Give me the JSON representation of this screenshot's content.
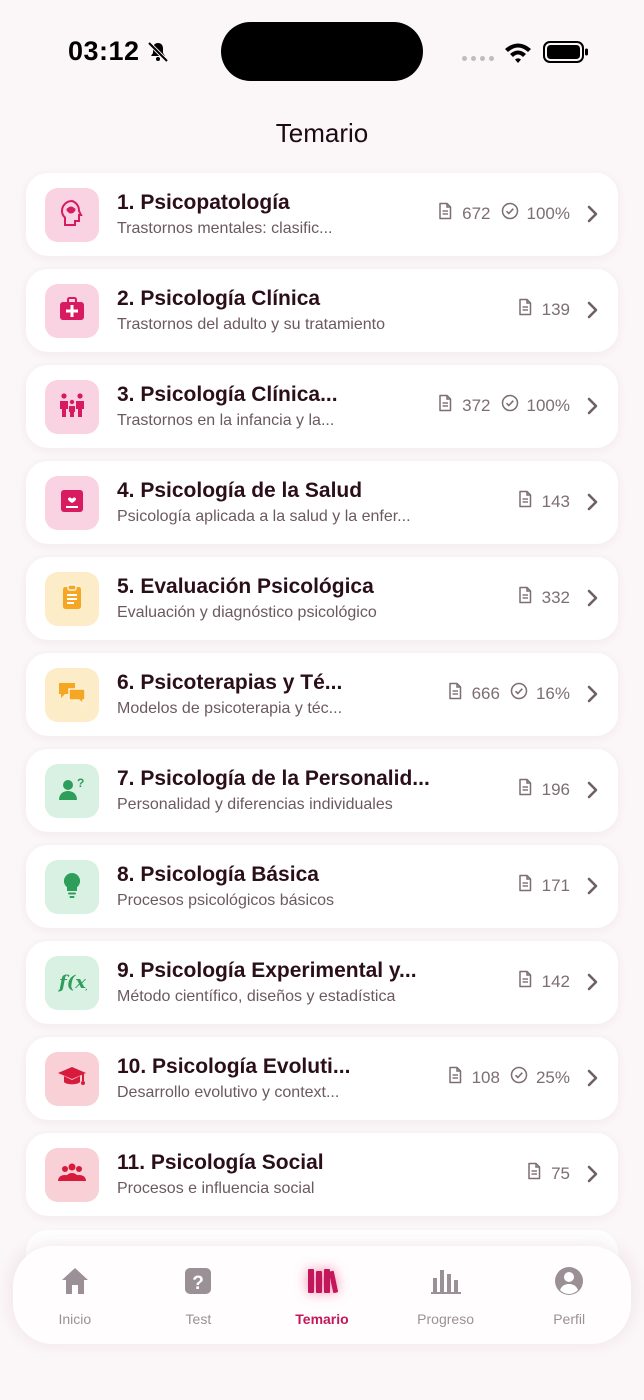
{
  "status": {
    "time": "03:12"
  },
  "page_title": "Temario",
  "topics": [
    {
      "title": "1. Psicopatología",
      "subtitle": "Trastornos mentales: clasific...",
      "count": "672",
      "progress": "100%",
      "icon": "brain-head-icon",
      "tone": "pink"
    },
    {
      "title": "2. Psicología Clínica",
      "subtitle": "Trastornos del adulto y su tratamiento",
      "count": "139",
      "progress": "",
      "icon": "medical-kit-icon",
      "tone": "pink"
    },
    {
      "title": "3. Psicología Clínica...",
      "subtitle": "Trastornos en la infancia y la...",
      "count": "372",
      "progress": "100%",
      "icon": "family-icon",
      "tone": "pink"
    },
    {
      "title": "4. Psicología de la Salud",
      "subtitle": "Psicología aplicada a la salud y la enfer...",
      "count": "143",
      "progress": "",
      "icon": "health-card-icon",
      "tone": "pink"
    },
    {
      "title": "5. Evaluación Psicológica",
      "subtitle": "Evaluación y diagnóstico psicológico",
      "count": "332",
      "progress": "",
      "icon": "clipboard-icon",
      "tone": "amber"
    },
    {
      "title": "6. Psicoterapias y Té...",
      "subtitle": "Modelos de psicoterapia y téc...",
      "count": "666",
      "progress": "16%",
      "icon": "chat-bubbles-icon",
      "tone": "amber"
    },
    {
      "title": "7. Psicología de la Personalid...",
      "subtitle": "Personalidad y diferencias individuales",
      "count": "196",
      "progress": "",
      "icon": "person-question-icon",
      "tone": "green"
    },
    {
      "title": "8. Psicología Básica",
      "subtitle": "Procesos psicológicos básicos",
      "count": "171",
      "progress": "",
      "icon": "lightbulb-icon",
      "tone": "green"
    },
    {
      "title": "9. Psicología Experimental y...",
      "subtitle": "Método científico, diseños y estadística",
      "count": "142",
      "progress": "",
      "icon": "function-icon",
      "tone": "green"
    },
    {
      "title": "10. Psicología Evoluti...",
      "subtitle": "Desarrollo evolutivo y context...",
      "count": "108",
      "progress": "25%",
      "icon": "graduation-cap-icon",
      "tone": "red"
    },
    {
      "title": "11. Psicología Social",
      "subtitle": "Procesos e influencia social",
      "count": "75",
      "progress": "",
      "icon": "group-icon",
      "tone": "red"
    }
  ],
  "nav": [
    {
      "label": "Inicio",
      "icon": "home-icon",
      "active": false
    },
    {
      "label": "Test",
      "icon": "question-icon",
      "active": false
    },
    {
      "label": "Temario",
      "icon": "books-icon",
      "active": true
    },
    {
      "label": "Progreso",
      "icon": "bar-chart-icon",
      "active": false
    },
    {
      "label": "Perfil",
      "icon": "profile-icon",
      "active": false
    }
  ],
  "colors": {
    "pink_bg": "#f9d3e2",
    "pink_fg": "#d81b60",
    "amber_bg": "#fcecc8",
    "amber_fg": "#f5a623",
    "green_bg": "#d9f1e3",
    "green_fg": "#2e9e5b",
    "red_bg": "#f8d0d6",
    "red_fg": "#d81b3c",
    "accent": "#c2185b"
  }
}
